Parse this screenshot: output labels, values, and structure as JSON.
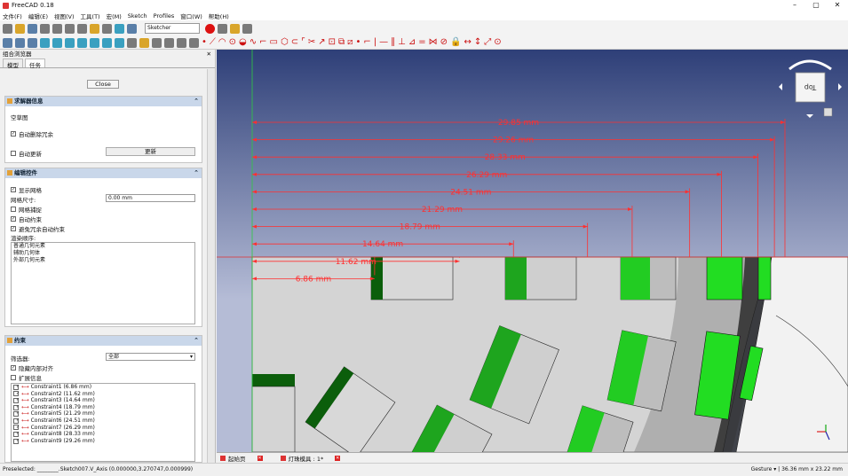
{
  "window": {
    "title": "FreeCAD 0.18",
    "minimize": "–",
    "maximize": "▢",
    "close": "✕"
  },
  "menu": [
    "文件(F)",
    "编辑(E)",
    "视图(V)",
    "工具(T)",
    "宏(M)",
    "Sketch",
    "Profiles",
    "窗口(W)",
    "帮助(H)"
  ],
  "toolbar": {
    "workbench": "Sketcher"
  },
  "panel": {
    "header": "组合浏览器",
    "close_x": "✕",
    "tabs": [
      "模型",
      "任务"
    ],
    "close_button": "Close",
    "solver": {
      "title": "求解器信息",
      "status": "空草图",
      "auto_remove": "自动删除冗余",
      "auto_update": "自动更新",
      "update_button": "更新"
    },
    "edit": {
      "title": "编辑控件",
      "show_grid": "显示网格",
      "grid_size_label": "网格尺寸:",
      "grid_size_value": "0.00 mm",
      "grid_snap": "网格捕捉",
      "auto_constraints": "自动约束",
      "avoid_redundant": "避免冗余自动约束",
      "render_order_label": "渲染顺序:",
      "render_order": [
        "普通几何元素",
        "辅助几何体",
        "外部几何元素"
      ]
    },
    "constraints": {
      "title": "约束",
      "filter_label": "筛选器:",
      "filter_value": "全部",
      "hide_internal": "隐藏内部对齐",
      "extended_info": "扩展信息",
      "items": [
        "Constraint1 (6.86 mm)",
        "Constraint2 (11.62 mm)",
        "Constraint3 (14.64 mm)",
        "Constraint4 (18.79 mm)",
        "Constraint5 (21.29 mm)",
        "Constraint6 (24.51 mm)",
        "Constraint7 (26.29 mm)",
        "Constraint8 (28.33 mm)",
        "Constraint9 (29.26 mm)"
      ]
    }
  },
  "view": {
    "dimensions": [
      "29.85 mm",
      "29.26 mm",
      "28.33 mm",
      "26.29 mm",
      "24.51 mm",
      "21.29 mm",
      "18.79 mm",
      "14.64 mm",
      "11.62 mm",
      "6.86 mm"
    ],
    "cube_label": "Top",
    "tabs": [
      "起始页",
      "灯珠模具 : 1*"
    ]
  },
  "status": {
    "preselected": "Preselected: ________.Sketch007.V_Axis (0.000000,3.270747,0.000999)",
    "nav": "Gesture ▾",
    "size": "36.36 mm x 23.22 mm"
  },
  "colors": {
    "dim": "#ff3030",
    "green_dark": "#0b5e0b",
    "green": "#22cc22",
    "panel_header": "#c9d7ea"
  }
}
